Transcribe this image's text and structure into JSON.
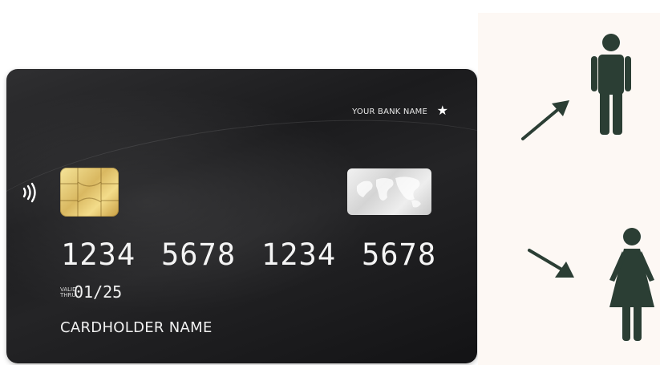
{
  "card": {
    "bank_name": "YOUR BANK NAME",
    "number_groups": [
      "1234",
      "5678",
      "1234",
      "5678"
    ],
    "valid_label_line1": "VALID",
    "valid_label_line2": "THRU",
    "expiry": "01/25",
    "holder": "CARDHOLDER NAME",
    "icons": [
      "star-icon",
      "contactless-icon",
      "chip-icon",
      "hologram-icon"
    ]
  },
  "panel": {
    "icons": [
      "arrow-up-right-icon",
      "man-icon",
      "arrow-down-right-icon",
      "woman-icon"
    ],
    "figure_color": "#2b3e34",
    "background_color": "#fdf8f4"
  }
}
